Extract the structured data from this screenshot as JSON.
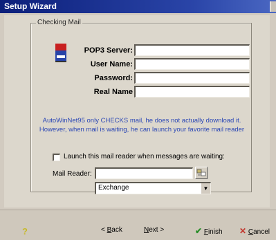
{
  "window": {
    "title": "Setup Wizard"
  },
  "group": {
    "title": "Checking Mail"
  },
  "fields": [
    {
      "label": "POP3 Server:",
      "value": ""
    },
    {
      "label": "User Name:",
      "value": ""
    },
    {
      "label": "Password:",
      "value": ""
    },
    {
      "label": "Real Name",
      "value": ""
    }
  ],
  "info_lines": [
    "AutoWinNet95 only CHECKS mail, he does not actually download it.",
    "However, when mail is waiting, he can launch your favorite mail reader"
  ],
  "launch_checkbox": {
    "label": "Launch this mail reader when messages are waiting:",
    "checked": false
  },
  "mail_reader": {
    "label": "Mail Reader:",
    "value": "",
    "select_value": "Exchange"
  },
  "buttons": {
    "help": "?",
    "back": {
      "prefix": "< ",
      "underline": "B",
      "rest": "ack"
    },
    "next": {
      "underline": "N",
      "rest": "ext >"
    },
    "finish": {
      "underline": "F",
      "rest": "inish"
    },
    "cancel": {
      "underline": "C",
      "rest": "ancel"
    }
  },
  "icons": {
    "mail": "mail-icon",
    "browse": "browse-icon",
    "dropdown": "chevron-down-icon"
  }
}
